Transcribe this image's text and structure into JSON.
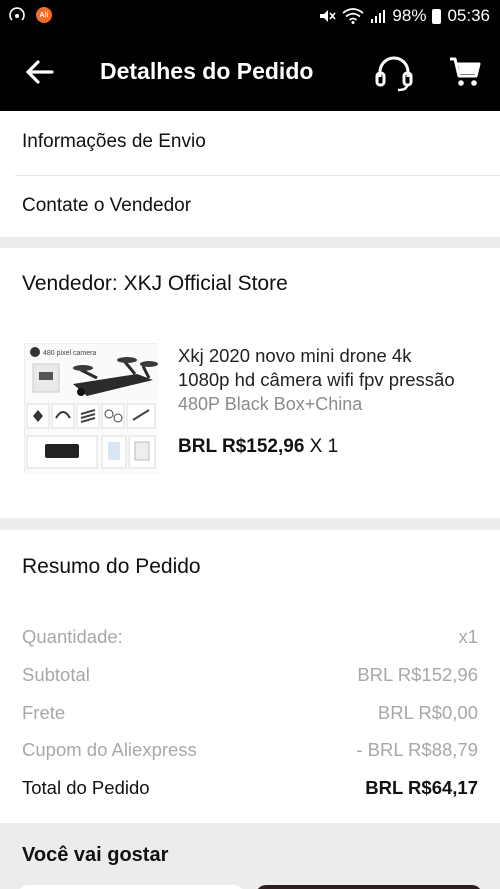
{
  "status_bar": {
    "app_badge": "Ali",
    "battery": "98%",
    "time": "05:36"
  },
  "header": {
    "title": "Detalhes do Pedido"
  },
  "menu": {
    "shipping_info": "Informações de Envio",
    "contact_seller": "Contate o Vendedor"
  },
  "order_item": {
    "seller": "Vendedor: XKJ Official Store",
    "title_line1": "Xkj 2020 novo mini drone 4k",
    "title_line2": "1080p hd câmera wifi fpv pressão",
    "variant": "480P Black Box+China",
    "price": "BRL R$152,96",
    "quantity": "X 1",
    "thumb_caption": "480 pixel camera"
  },
  "summary": {
    "title": "Resumo do Pedido",
    "rows": [
      {
        "label": "Quantidade:",
        "value": "x1"
      },
      {
        "label": "Subtotal",
        "value": "BRL R$152,96"
      },
      {
        "label": "Frete",
        "value": "BRL R$0,00"
      },
      {
        "label": "Cupom do Aliexpress",
        "value": "- BRL R$88,79"
      },
      {
        "label": "Total do Pedido",
        "value": "BRL R$64,17"
      }
    ]
  },
  "recommendations": {
    "title": "Você vai gostar"
  },
  "colors": {
    "header_bg": "#000000",
    "muted_text": "#a8a8a8",
    "app_badge": "#f26b2a"
  }
}
